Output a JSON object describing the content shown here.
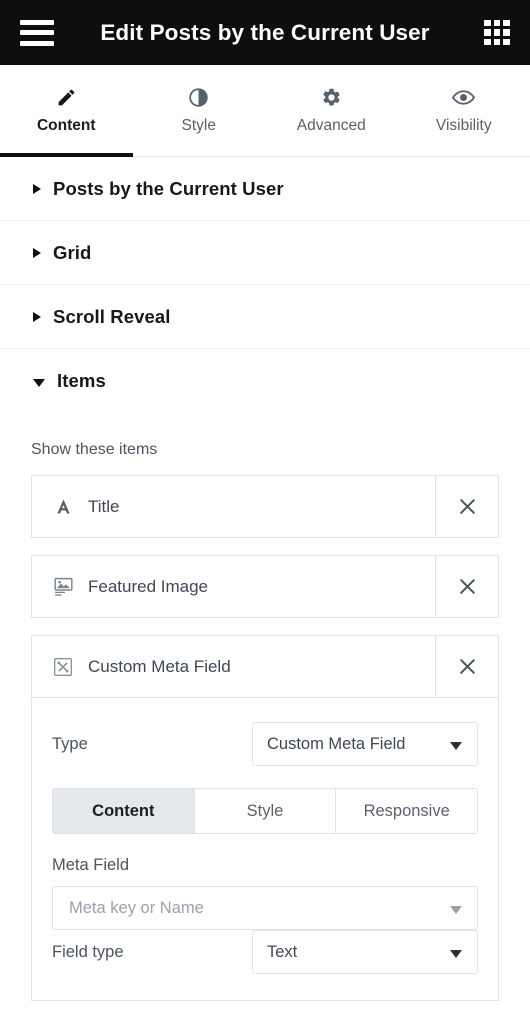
{
  "topbar": {
    "menu_icon": "hamburger-menu-icon",
    "title": "Edit Posts by the Current User",
    "apps_icon": "apps-grid-icon"
  },
  "tabs": [
    {
      "label": "Content",
      "icon": "pencil-icon",
      "active": true
    },
    {
      "label": "Style",
      "icon": "contrast-icon",
      "active": false
    },
    {
      "label": "Advanced",
      "icon": "gear-icon",
      "active": false
    },
    {
      "label": "Visibility",
      "icon": "eye-icon",
      "active": false
    }
  ],
  "sections": [
    {
      "title": "Posts by the Current User",
      "expanded": false
    },
    {
      "title": "Grid",
      "expanded": false
    },
    {
      "title": "Scroll Reveal",
      "expanded": false
    },
    {
      "title": "Items",
      "expanded": true
    }
  ],
  "items_panel": {
    "list_label": "Show these items",
    "items": [
      {
        "label": "Title",
        "icon": "letter-a-icon",
        "remove_icon": "close-x-icon",
        "expanded": false
      },
      {
        "label": "Featured Image",
        "icon": "image-icon",
        "remove_icon": "close-x-icon",
        "expanded": false
      },
      {
        "label": "Custom Meta Field",
        "icon": "meta-field-icon",
        "remove_icon": "close-x-icon",
        "expanded": true
      }
    ],
    "expanded_item": {
      "type_label": "Type",
      "type_value": "Custom Meta Field",
      "segments": [
        {
          "label": "Content",
          "active": true
        },
        {
          "label": "Style",
          "active": false
        },
        {
          "label": "Responsive",
          "active": false
        }
      ],
      "meta_field_label": "Meta Field",
      "meta_field_placeholder": "Meta key or Name",
      "field_type_label": "Field type",
      "field_type_value": "Text"
    }
  },
  "colors": {
    "topbar_bg": "#0e0e0e",
    "accent_underline": "#0e0e0e",
    "text_primary": "#16181a",
    "text_secondary": "#4b5460",
    "muted": "#9aa2ac",
    "border": "#dfe3e7",
    "segment_active_bg": "#e6e9eb"
  }
}
